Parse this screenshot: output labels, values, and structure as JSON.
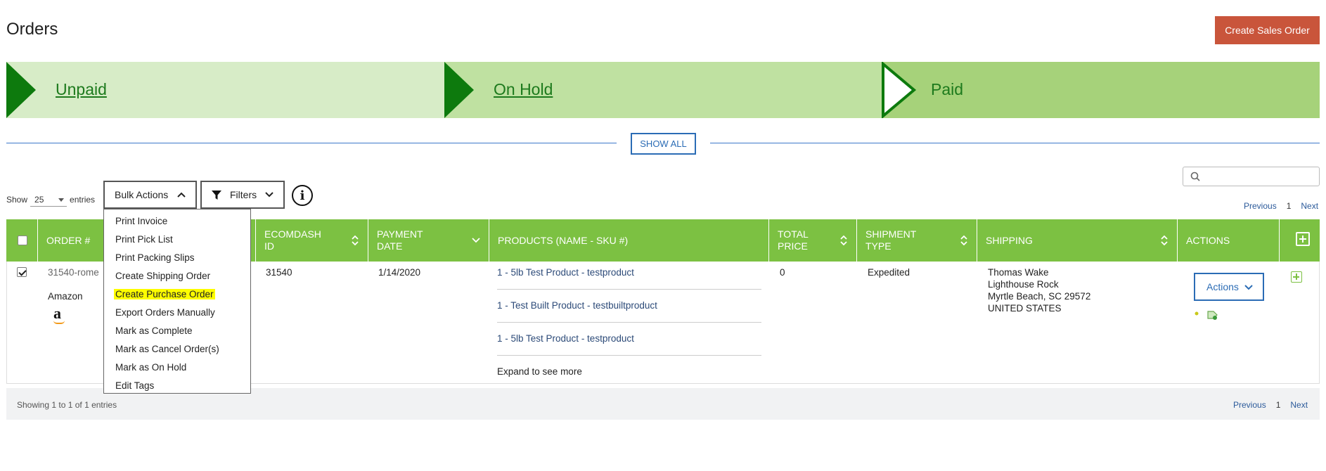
{
  "page": {
    "title": "Orders"
  },
  "header": {
    "create_sales_order": "Create Sales Order"
  },
  "pipeline": {
    "stages": [
      {
        "label": "Unpaid",
        "link": true
      },
      {
        "label": "On Hold",
        "link": true
      },
      {
        "label": "Paid",
        "link": false
      }
    ],
    "show_all": "SHOW ALL"
  },
  "colors": {
    "accent_green": "#7cc142",
    "brand_orange": "#c9553b",
    "link_blue": "#2b6cb5",
    "highlight": "#fdfd00"
  },
  "toolbar": {
    "show_label": "Show",
    "entries_value": "25",
    "entries_label": "entries",
    "bulk_actions": "Bulk Actions",
    "filters": "Filters",
    "search_placeholder": ""
  },
  "pager_top": {
    "previous": "Previous",
    "page": "1",
    "next": "Next"
  },
  "bulk_menu": {
    "items": [
      {
        "label": "Print Invoice"
      },
      {
        "label": "Print Pick List"
      },
      {
        "label": "Print Packing Slips"
      },
      {
        "label": "Create Shipping Order"
      },
      {
        "label": "Create Purchase Order",
        "highlighted": true
      },
      {
        "label": "Export Orders Manually"
      },
      {
        "label": "Mark as Complete"
      },
      {
        "label": "Mark as Cancel Order(s)"
      },
      {
        "label": "Mark as On Hold"
      },
      {
        "label": "Edit Tags"
      }
    ]
  },
  "table": {
    "columns": {
      "order": "ORDER #",
      "ecomdash_id": "ECOMDASH ID",
      "payment_date": "PAYMENT DATE",
      "products": "PRODUCTS (NAME - SKU #)",
      "total_price": "TOTAL PRICE",
      "shipment_type": "SHIPMENT TYPE",
      "shipping": "SHIPPING",
      "actions": "ACTIONS"
    },
    "rows": [
      {
        "checked": true,
        "order_no": "31540-rome",
        "channel": "Amazon",
        "channel_logo": "a",
        "ecomdash_id": "31540",
        "payment_date": "1/14/2020",
        "products": [
          "1 - 5lb Test Product - testproduct",
          "1 - Test Built Product - testbuiltproduct",
          "1 - 5lb Test Product - testproduct"
        ],
        "expand": "Expand to see more",
        "total_price": "0",
        "shipment_type": "Expedited",
        "shipping": {
          "name": "Thomas Wake",
          "line1": "Lighthouse Rock",
          "city": "Myrtle Beach, SC 29572",
          "country": "UNITED STATES"
        },
        "actions_label": "Actions"
      }
    ]
  },
  "footer": {
    "info": "Showing 1 to 1 of 1 entries",
    "previous": "Previous",
    "page": "1",
    "next": "Next"
  }
}
